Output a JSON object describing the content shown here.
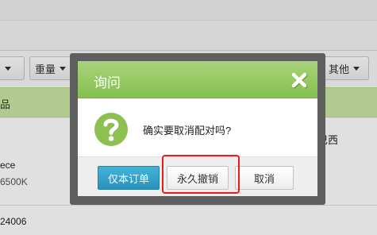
{
  "background": {
    "toolbar": [
      {
        "label": ""
      },
      {
        "label": "重量"
      },
      {
        "label": "其他"
      }
    ],
    "table_header_label": "品",
    "rows": [
      {
        "label": "ece"
      },
      {
        "label": "6500K"
      },
      {
        "label": "24006"
      }
    ],
    "right_text": "巴西"
  },
  "dialog": {
    "title": "询问",
    "message": "确实要取消配对吗?",
    "buttons": {
      "primary": "仅本订单",
      "revoke": "永久撤销",
      "cancel": "取消"
    }
  },
  "colors": {
    "header_green": "#86bf4f",
    "primary_blue": "#2a92bd",
    "highlight_red": "#e81c1c",
    "row_green": "#c9e6a4"
  }
}
